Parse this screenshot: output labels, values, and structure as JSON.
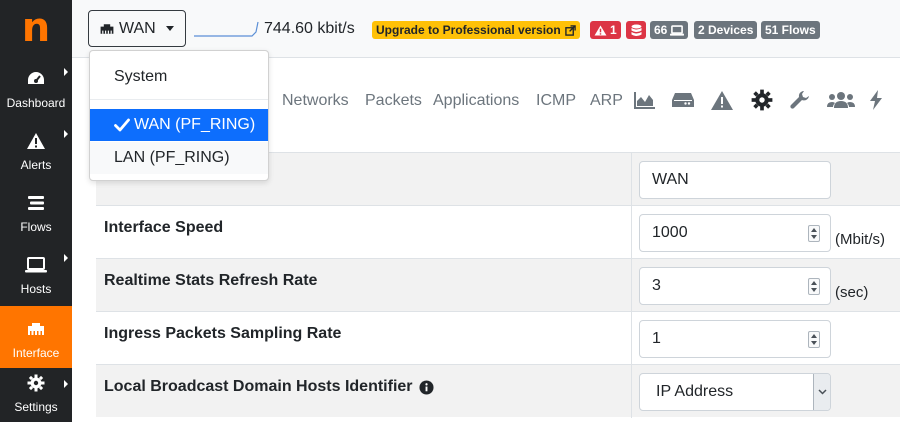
{
  "app": {
    "logo_letter": "n"
  },
  "sidebar": {
    "items": [
      {
        "label": "Dashboard",
        "icon": "dashboard-gauge-icon",
        "has_submenu": true
      },
      {
        "label": "Alerts",
        "icon": "warning-triangle-icon",
        "has_submenu": true
      },
      {
        "label": "Flows",
        "icon": "stream-icon",
        "has_submenu": false
      },
      {
        "label": "Hosts",
        "icon": "laptop-icon",
        "has_submenu": true
      },
      {
        "label": "Interface",
        "icon": "ethernet-icon",
        "has_submenu": false,
        "active": true
      },
      {
        "label": "Settings",
        "icon": "gear-icon",
        "has_submenu": true
      }
    ]
  },
  "topbar": {
    "interface_label": "WAN",
    "throughput": "744.60 kbit/s",
    "upgrade_label": "Upgrade to Professional version",
    "badges": [
      {
        "text": "1",
        "color": "red",
        "icon": "warning-triangle-icon"
      },
      {
        "text": "",
        "color": "red",
        "icon": "database-icon"
      },
      {
        "text": "66",
        "color": "grey",
        "icon": "laptop-icon"
      },
      {
        "text": "2 Devices",
        "color": "grey"
      },
      {
        "text": "51 Flows",
        "color": "grey"
      }
    ]
  },
  "dropdown": {
    "items": [
      {
        "label": "System",
        "active": false
      },
      {
        "label": "WAN (PF_RING)",
        "active": true
      },
      {
        "label": "LAN (PF_RING)",
        "active": false
      }
    ]
  },
  "tabs": {
    "labels": [
      "Networks",
      "Packets",
      "Applications",
      "ICMP",
      "ARP"
    ],
    "icons": [
      "area-chart-icon",
      "hdd-icon",
      "warning-triangle-icon",
      "gear-icon",
      "wrench-icon",
      "users-icon",
      "bolt-icon"
    ]
  },
  "settings": {
    "rows": [
      {
        "label": "",
        "value": "WAN",
        "type": "text",
        "unit": ""
      },
      {
        "label": "Interface Speed",
        "value": "1000",
        "type": "number",
        "unit": "(Mbit/s)"
      },
      {
        "label": "Realtime Stats Refresh Rate",
        "value": "3",
        "type": "number",
        "unit": "(sec)"
      },
      {
        "label": "Ingress Packets Sampling Rate",
        "value": "1",
        "type": "number",
        "unit": ""
      },
      {
        "label": "Local Broadcast Domain Hosts Identifier",
        "value": "IP Address",
        "type": "select",
        "unit": "",
        "info": true
      }
    ]
  },
  "colors": {
    "accent": "#ff7500",
    "sidebar_bg": "#222426",
    "primary": "#0d6efd",
    "danger": "#dc3545",
    "warning": "#ffc107",
    "secondary": "#6c757d"
  }
}
